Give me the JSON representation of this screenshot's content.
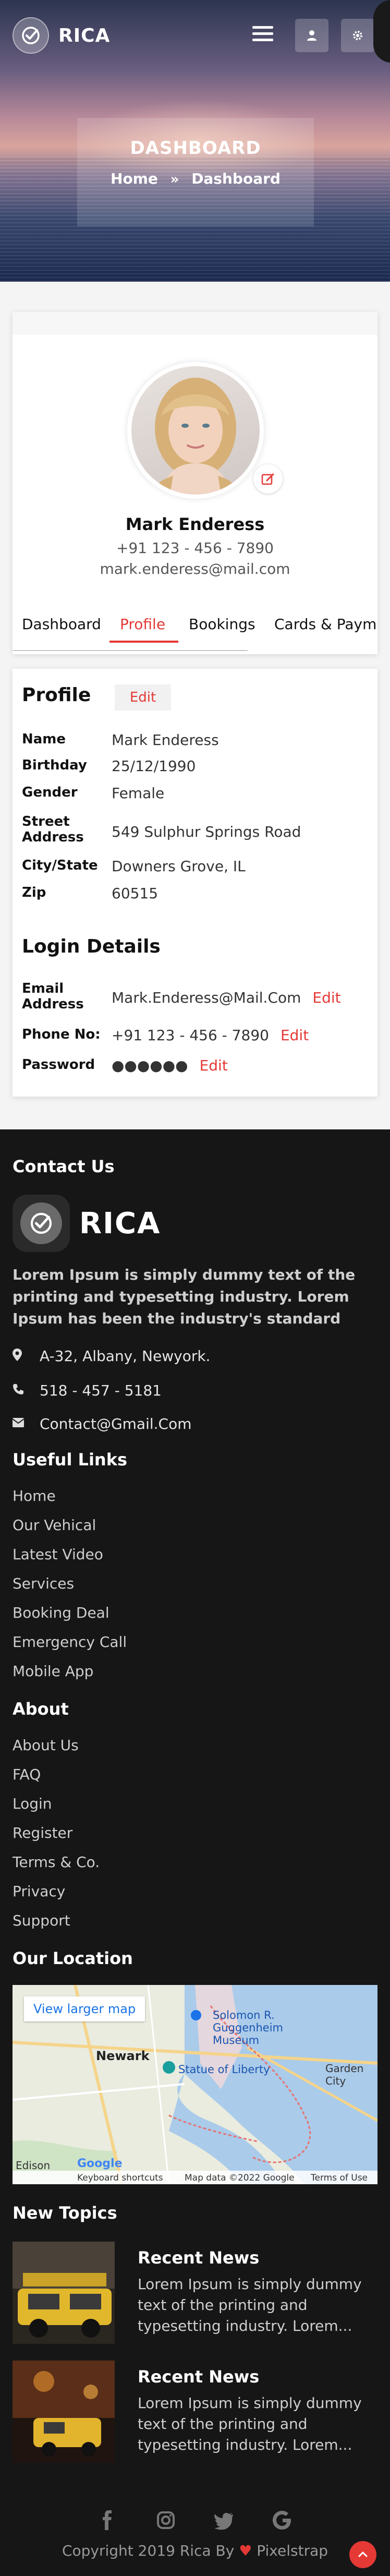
{
  "brand": {
    "name": "RICA"
  },
  "header": {
    "page_title": "DASHBOARD",
    "breadcrumb_home": "Home",
    "breadcrumb_separator": "»",
    "breadcrumb_current": "Dashboard"
  },
  "profile": {
    "name": "Mark Enderess",
    "phone": "+91 123 - 456 - 7890",
    "email": "mark.enderess@mail.com"
  },
  "tabs": [
    {
      "label": "Dashboard",
      "active": false
    },
    {
      "label": "Profile",
      "active": true
    },
    {
      "label": "Bookings",
      "active": false
    },
    {
      "label": "Cards & Payments",
      "active": false
    }
  ],
  "profile_section": {
    "title": "Profile",
    "edit_label": "Edit",
    "rows": [
      {
        "label": "Name",
        "value": "Mark Enderess"
      },
      {
        "label": "Birthday",
        "value": "25/12/1990"
      },
      {
        "label": "Gender",
        "value": "Female"
      },
      {
        "label": "Street Address",
        "value": "549 Sulphur Springs Road"
      },
      {
        "label": "City/State",
        "value": "Downers Grove, IL"
      },
      {
        "label": "Zip",
        "value": "60515"
      }
    ]
  },
  "login_section": {
    "title": "Login Details",
    "rows": [
      {
        "label": "Email Address",
        "value": "Mark.Enderess@Mail.Com",
        "edit": "Edit"
      },
      {
        "label": "Phone No:",
        "value": "+91 123 - 456 - 7890",
        "edit": "Edit"
      },
      {
        "label": "Password",
        "value": "●●●●●●",
        "edit": "Edit"
      }
    ]
  },
  "footer": {
    "contact_title": "Contact Us",
    "about_text": "Lorem Ipsum is simply dummy text of the printing and typesetting industry. Lorem Ipsum has been the industry's standard dummy text ever since th...",
    "address": "A-32, Albany, Newyork.",
    "phone": "518 - 457 - 5181",
    "email": "Contact@Gmail.Com",
    "useful_links_title": "Useful Links",
    "useful_links": [
      "Home",
      "Our Vehical",
      "Latest Video",
      "Services",
      "Booking Deal",
      "Emergency Call",
      "Mobile App"
    ],
    "about_title": "About",
    "about_links": [
      "About Us",
      "FAQ",
      "Login",
      "Register",
      "Terms & Co.",
      "Privacy",
      "Support"
    ],
    "location_title": "Our Location",
    "map": {
      "button": "View larger map",
      "labels": [
        "Solomon R. Guggenheim Museum",
        "Statue of Liberty",
        "Newark",
        "Garden City",
        "Edison"
      ],
      "shortcuts": "Keyboard shortcuts",
      "copyright": "Map data ©2022 Google",
      "terms": "Terms of Use",
      "google": "Google"
    },
    "news_title": "New Topics",
    "news": [
      {
        "title": "Recent News",
        "text": "Lorem Ipsum is simply dummy text of the printing and typesetting industry. Lorem..."
      },
      {
        "title": "Recent News",
        "text": "Lorem Ipsum is simply dummy text of the printing and typesetting industry. Lorem..."
      }
    ],
    "copyright_prefix": "Copyright 2019 Rica By",
    "copyright_suffix": "Pixelstrap"
  },
  "colors": {
    "accent": "#e53935",
    "footer_bg": "#161616"
  },
  "icons": [
    "check-logo-icon",
    "menu-icon",
    "user-icon",
    "gear-icon",
    "edit-icon",
    "map-marker-icon",
    "phone-icon",
    "envelope-icon",
    "facebook-icon",
    "instagram-icon",
    "twitter-icon",
    "google-icon",
    "heart-icon"
  ]
}
